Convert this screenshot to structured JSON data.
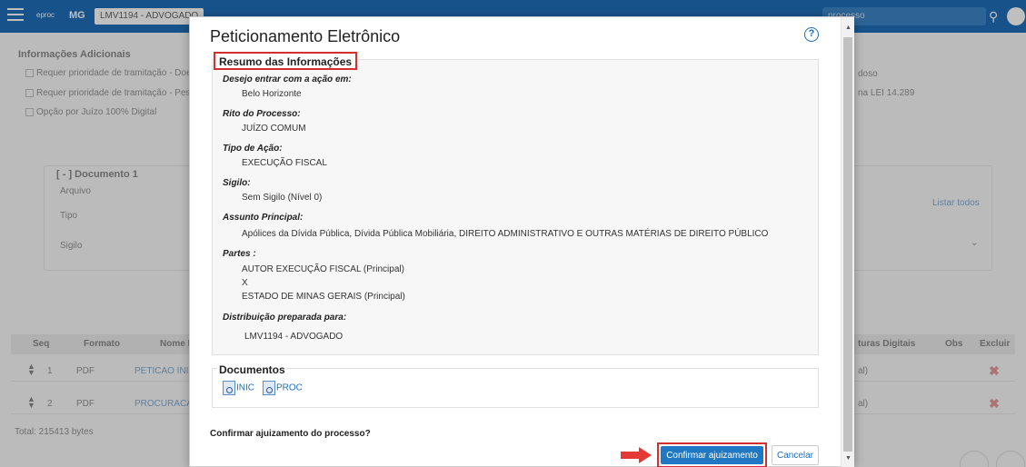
{
  "header": {
    "uf": "MG",
    "user_select": "LMV1194 - ADVOGADO",
    "search_placeholder": "processo"
  },
  "background": {
    "info_title": "Informações Adicionais",
    "checkbox1": "Requer prioridade de tramitação - Doe",
    "checkbox2": "Requer prioridade de tramitação - Pes",
    "checkbox3": "Opção por Juízo 100% Digital",
    "right_text1": "doso",
    "right_text2": "na LEI 14.289",
    "doc_title": "[ - ] Documento 1",
    "arquivo_label": "Arquivo",
    "tipo_label": "Tipo",
    "sigilo_label": "Sigilo",
    "listar_todos": "Listar todos",
    "table_headers": {
      "seq": "Seq",
      "formato": "Formato",
      "nome": "Nome D",
      "assinaturas": "turas Digitais",
      "obs": "Obs",
      "excluir": "Excluir"
    },
    "rows": [
      {
        "seq": "1",
        "formato": "PDF",
        "nome": "PETICAO INIC",
        "assin": "al)"
      },
      {
        "seq": "2",
        "formato": "PDF",
        "nome": "PROCURACAO",
        "assin": "al)"
      }
    ],
    "total": "Total: 215413 bytes"
  },
  "modal": {
    "title": "Peticionamento Eletrônico",
    "summary_legend": "Resumo das Informações",
    "fields": [
      {
        "label": "Desejo entrar com a ação em:",
        "value": "Belo Horizonte"
      },
      {
        "label": "Rito do Processo:",
        "value": "JUÍZO COMUM"
      },
      {
        "label": "Tipo de Ação:",
        "value": "EXECUÇÃO FISCAL"
      },
      {
        "label": "Sigilo:",
        "value": "Sem Sigilo (Nível 0)"
      },
      {
        "label": "Assunto Principal:",
        "value": "Apólices da Dívida Pública, Dívida Pública Mobiliária, DIREITO ADMINISTRATIVO E OUTRAS MATÉRIAS DE DIREITO PÚBLICO"
      }
    ],
    "partes_label": "Partes :",
    "parte_autor": "AUTOR EXECUÇÃO FISCAL (Principal)",
    "parte_x": "X",
    "parte_reu": "ESTADO DE MINAS GERAIS (Principal)",
    "distribuicao_label": "Distribuição preparada para:",
    "distribuicao_value": "LMV1194 - ADVOGADO",
    "docs_legend": "Documentos",
    "docs": [
      "INIC",
      "PROC"
    ],
    "confirm_question": "Confirmar ajuizamento do processo?",
    "confirm_button": "Confirmar ajuizamento",
    "cancel_button": "Cancelar"
  }
}
